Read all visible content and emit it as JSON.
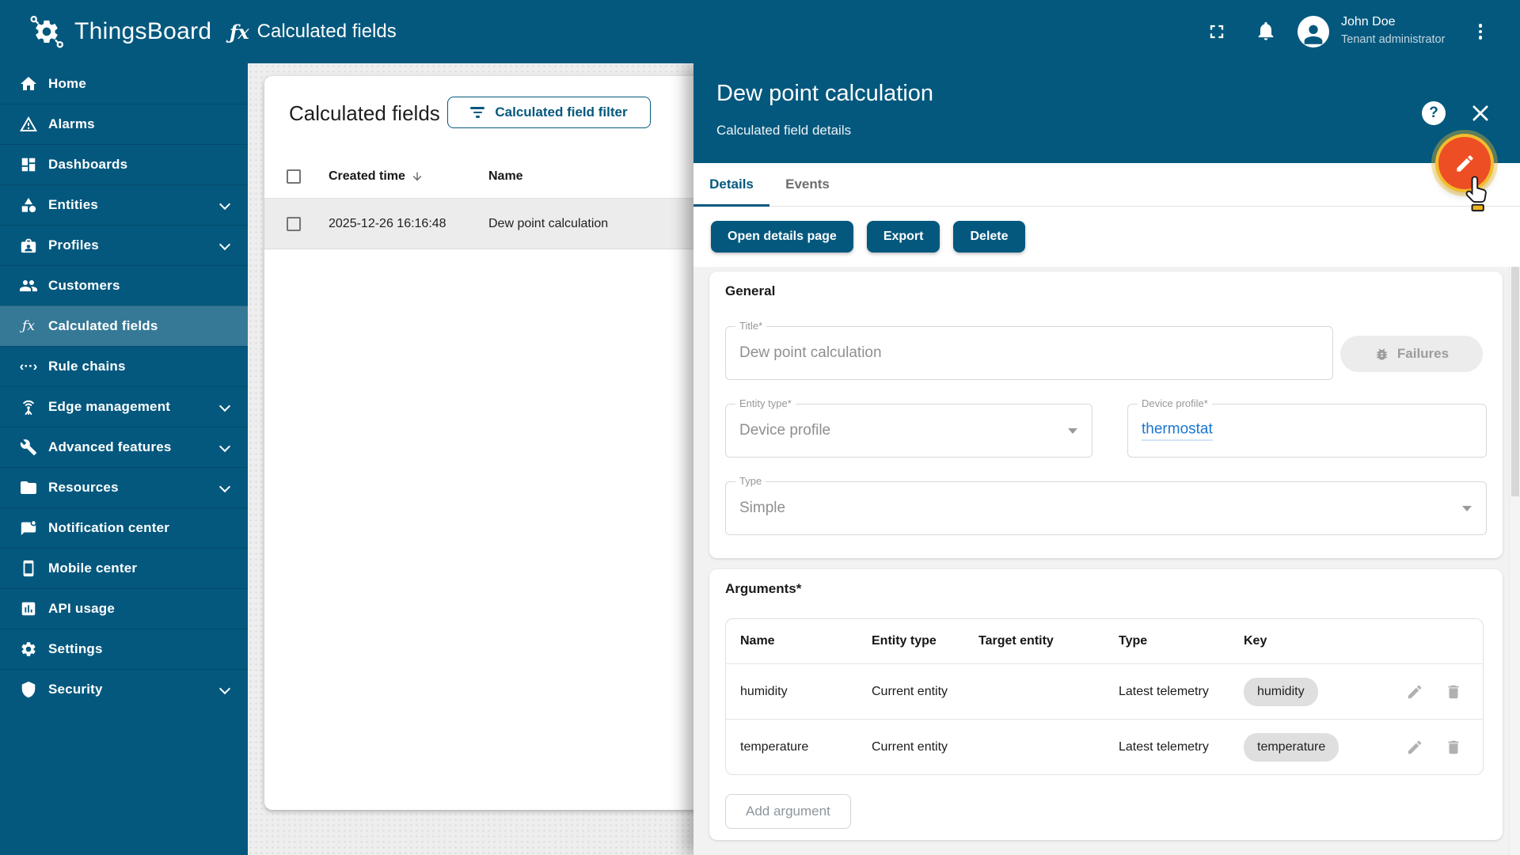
{
  "topbar": {
    "brand": "ThingsBoard",
    "page_title": "Calculated fields",
    "user": {
      "name": "John Doe",
      "role": "Tenant administrator"
    }
  },
  "glyphs": {
    "fx": "ƒx",
    "rule_chains": "‹··›",
    "help": "?"
  },
  "sidebar": {
    "items": [
      {
        "label": "Home"
      },
      {
        "label": "Alarms"
      },
      {
        "label": "Dashboards"
      },
      {
        "label": "Entities"
      },
      {
        "label": "Profiles"
      },
      {
        "label": "Customers"
      },
      {
        "label": "Calculated fields"
      },
      {
        "label": "Rule chains"
      },
      {
        "label": "Edge management"
      },
      {
        "label": "Advanced features"
      },
      {
        "label": "Resources"
      },
      {
        "label": "Notification center"
      },
      {
        "label": "Mobile center"
      },
      {
        "label": "API usage"
      },
      {
        "label": "Settings"
      },
      {
        "label": "Security"
      }
    ]
  },
  "list": {
    "title": "Calculated fields",
    "filter_button": "Calculated field filter",
    "columns": [
      "Created time",
      "Name"
    ],
    "rows": [
      {
        "created_time": "2025-12-26 16:16:48",
        "name": "Dew point calculation"
      }
    ]
  },
  "panel": {
    "title": "Dew point calculation",
    "subtitle": "Calculated field details",
    "tabs": [
      {
        "label": "Details",
        "active": true
      },
      {
        "label": "Events",
        "active": false
      }
    ],
    "actions": {
      "open_details": "Open details page",
      "export": "Export",
      "delete": "Delete"
    },
    "general": {
      "heading": "General",
      "title_field": {
        "label": "Title*",
        "value": "Dew point calculation"
      },
      "failures_button": "Failures",
      "entity_type_field": {
        "label": "Entity type*",
        "value": "Device profile"
      },
      "device_profile_field": {
        "label": "Device profile*",
        "value": "thermostat"
      },
      "type_field": {
        "label": "Type",
        "value": "Simple"
      }
    },
    "arguments": {
      "heading": "Arguments*",
      "columns": [
        "Name",
        "Entity type",
        "Target entity",
        "Type",
        "Key"
      ],
      "rows": [
        {
          "name": "humidity",
          "entity_type": "Current entity",
          "target_entity": "",
          "type": "Latest telemetry",
          "key": "humidity"
        },
        {
          "name": "temperature",
          "entity_type": "Current entity",
          "target_entity": "",
          "type": "Latest telemetry",
          "key": "temperature"
        }
      ],
      "add_button": "Add argument"
    }
  },
  "colors": {
    "primary": "#04587e",
    "fab_orange": "#ee4e23",
    "highlight_ring": "#f2bd2d",
    "link_blue": "#1976d2",
    "selected_row": "#ececec",
    "chip_gray": "#dfdfdf"
  }
}
